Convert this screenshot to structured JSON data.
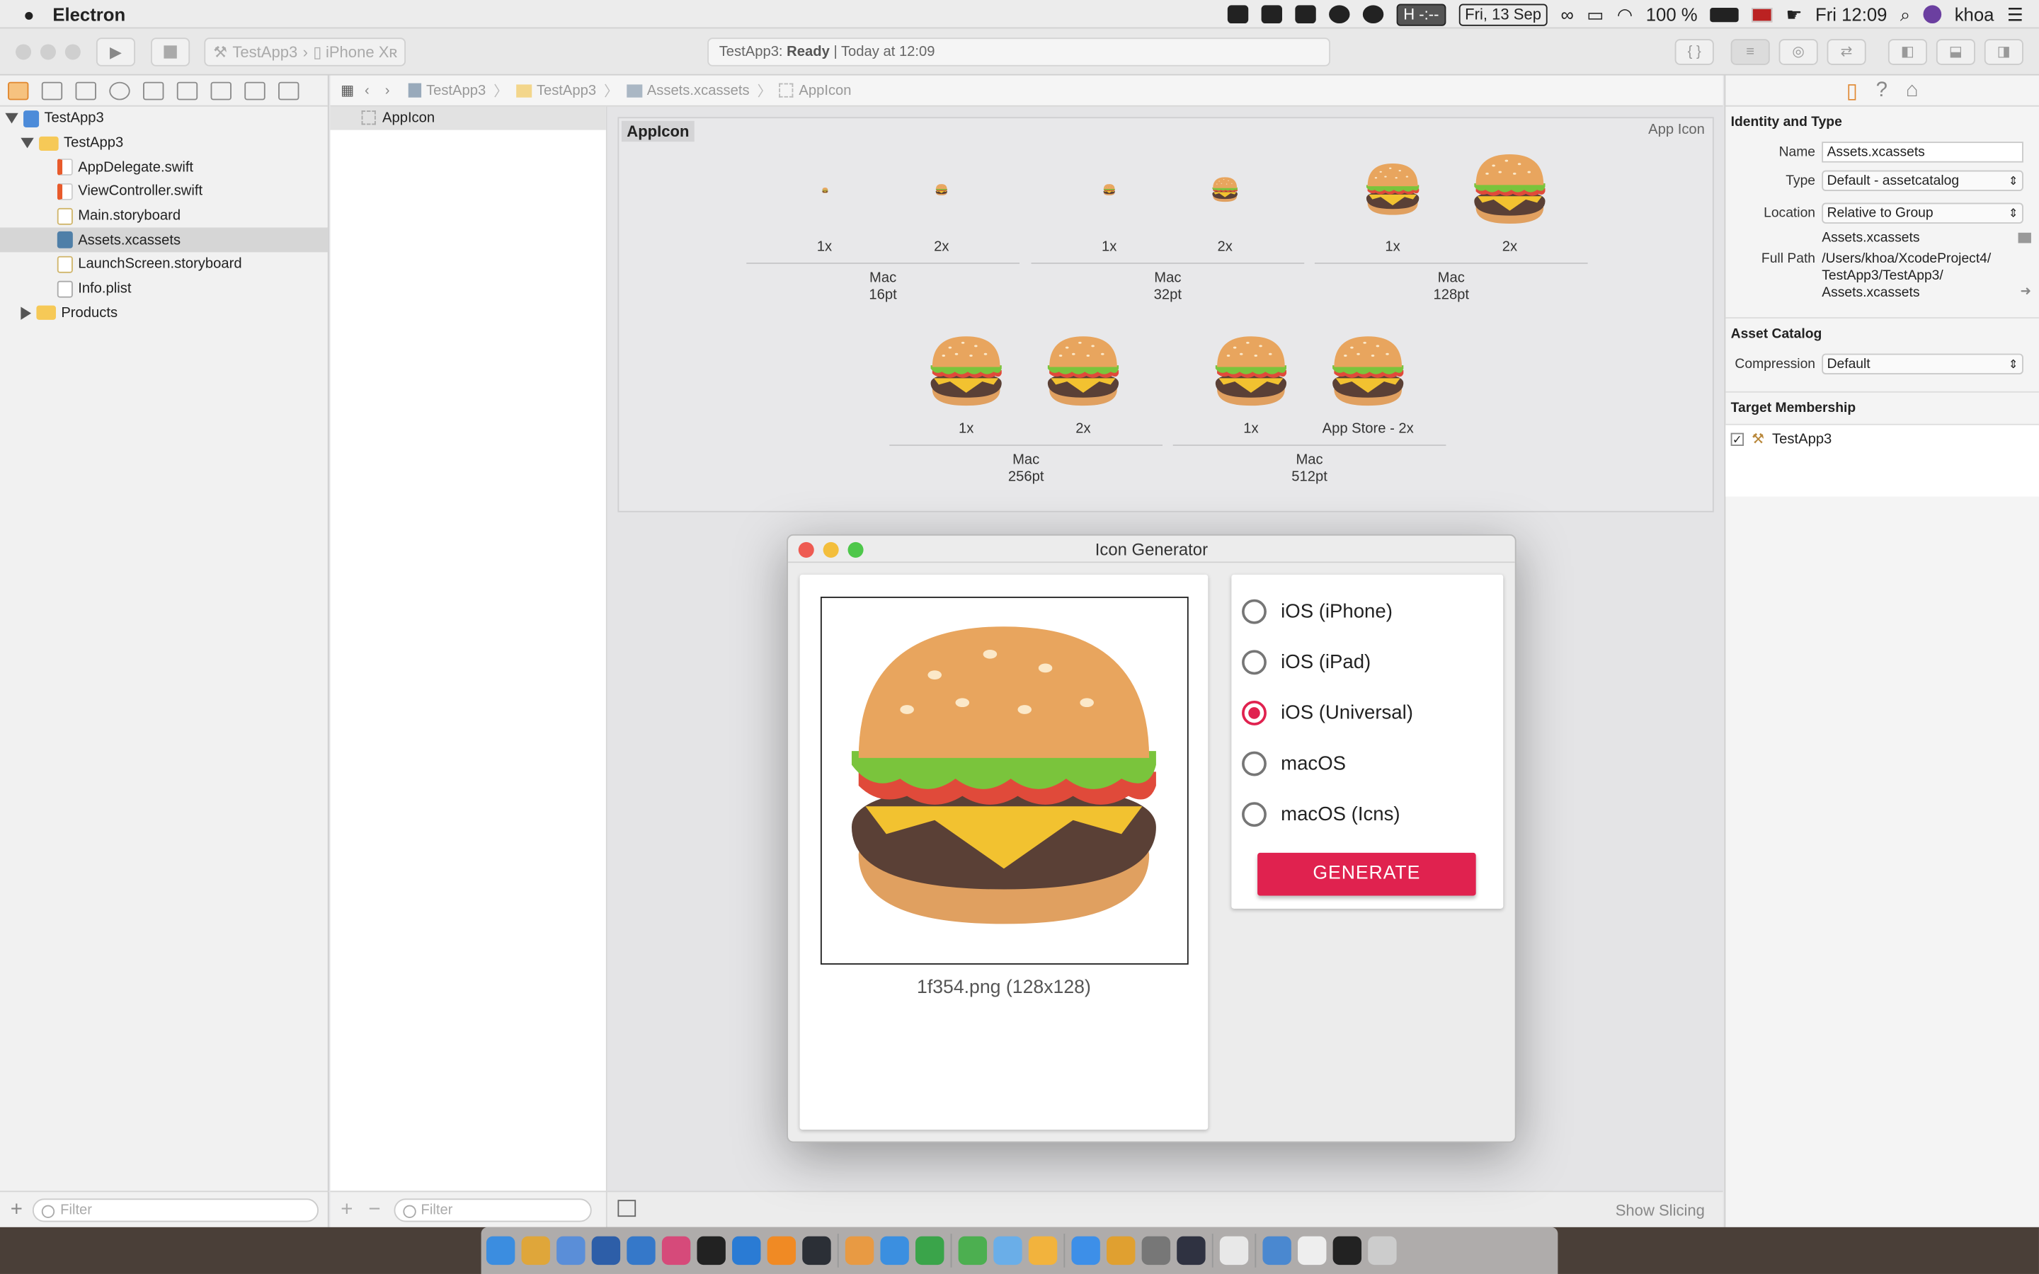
{
  "menubar": {
    "app_name": "Electron",
    "date": "Fri, 13 Sep",
    "clock_box": "-:--",
    "battery": "100 %",
    "time": "Fri 12:09",
    "user": "khoa"
  },
  "toolbar": {
    "scheme": "TestApp3",
    "device": "iPhone Xʀ",
    "status_project": "TestApp3: ",
    "status_state": "Ready",
    "status_time": " | Today at 12:09"
  },
  "navigator": {
    "items": [
      {
        "label": "TestApp3",
        "icon": "project-icon",
        "level": 0,
        "expanded": true
      },
      {
        "label": "TestApp3",
        "icon": "folder-icon",
        "level": 1,
        "expanded": true
      },
      {
        "label": "AppDelegate.swift",
        "icon": "swift-file-icon",
        "level": 2
      },
      {
        "label": "ViewController.swift",
        "icon": "swift-file-icon",
        "level": 2
      },
      {
        "label": "Main.storyboard",
        "icon": "storyboard-icon",
        "level": 2
      },
      {
        "label": "Assets.xcassets",
        "icon": "assets-icon",
        "level": 2,
        "selected": true
      },
      {
        "label": "LaunchScreen.storyboard",
        "icon": "storyboard-icon",
        "level": 2
      },
      {
        "label": "Info.plist",
        "icon": "plist-icon",
        "level": 2
      },
      {
        "label": "Products",
        "icon": "folder-icon",
        "level": 1,
        "expanded": false
      }
    ],
    "filter_placeholder": "Filter"
  },
  "jumpbar": {
    "crumbs": [
      "TestApp3",
      "TestApp3",
      "Assets.xcassets",
      "AppIcon"
    ]
  },
  "outline": {
    "item": "AppIcon",
    "filter_placeholder": "Filter"
  },
  "iconset": {
    "title": "AppIcon",
    "kind": "App Icon",
    "groups": [
      {
        "name": "Mac",
        "size": "16pt",
        "slots": [
          "1x",
          "2x"
        ]
      },
      {
        "name": "Mac",
        "size": "32pt",
        "slots": [
          "1x",
          "2x"
        ]
      },
      {
        "name": "Mac",
        "size": "128pt",
        "slots": [
          "1x",
          "2x"
        ]
      },
      {
        "name": "Mac",
        "size": "256pt",
        "slots": [
          "1x",
          "2x"
        ]
      },
      {
        "name": "Mac",
        "size": "512pt",
        "slots": [
          "1x",
          "App Store - 2x"
        ]
      }
    ],
    "show_slicing": "Show Slicing"
  },
  "inspector": {
    "identity_header": "Identity and Type",
    "name_label": "Name",
    "name_value": "Assets.xcassets",
    "type_label": "Type",
    "type_value": "Default - assetcatalog",
    "location_label": "Location",
    "location_value": "Relative to Group",
    "location_file": "Assets.xcassets",
    "fullpath_label": "Full Path",
    "fullpath_lines": [
      "/Users/khoa/XcodeProject4/",
      "TestApp3/TestApp3/",
      "Assets.xcassets"
    ],
    "catalog_header": "Asset Catalog",
    "compression_label": "Compression",
    "compression_value": "Default",
    "membership_header": "Target Membership",
    "target": "TestApp3"
  },
  "modal": {
    "title": "Icon Generator",
    "filename": "1f354.png (128x128)",
    "options": [
      {
        "label": "iOS (iPhone)",
        "selected": false
      },
      {
        "label": "iOS (iPad)",
        "selected": false
      },
      {
        "label": "iOS (Universal)",
        "selected": true
      },
      {
        "label": "macOS",
        "selected": false
      },
      {
        "label": "macOS (Icns)",
        "selected": false
      }
    ],
    "generate_label": "GENERATE",
    "accent": "#e0224f"
  }
}
